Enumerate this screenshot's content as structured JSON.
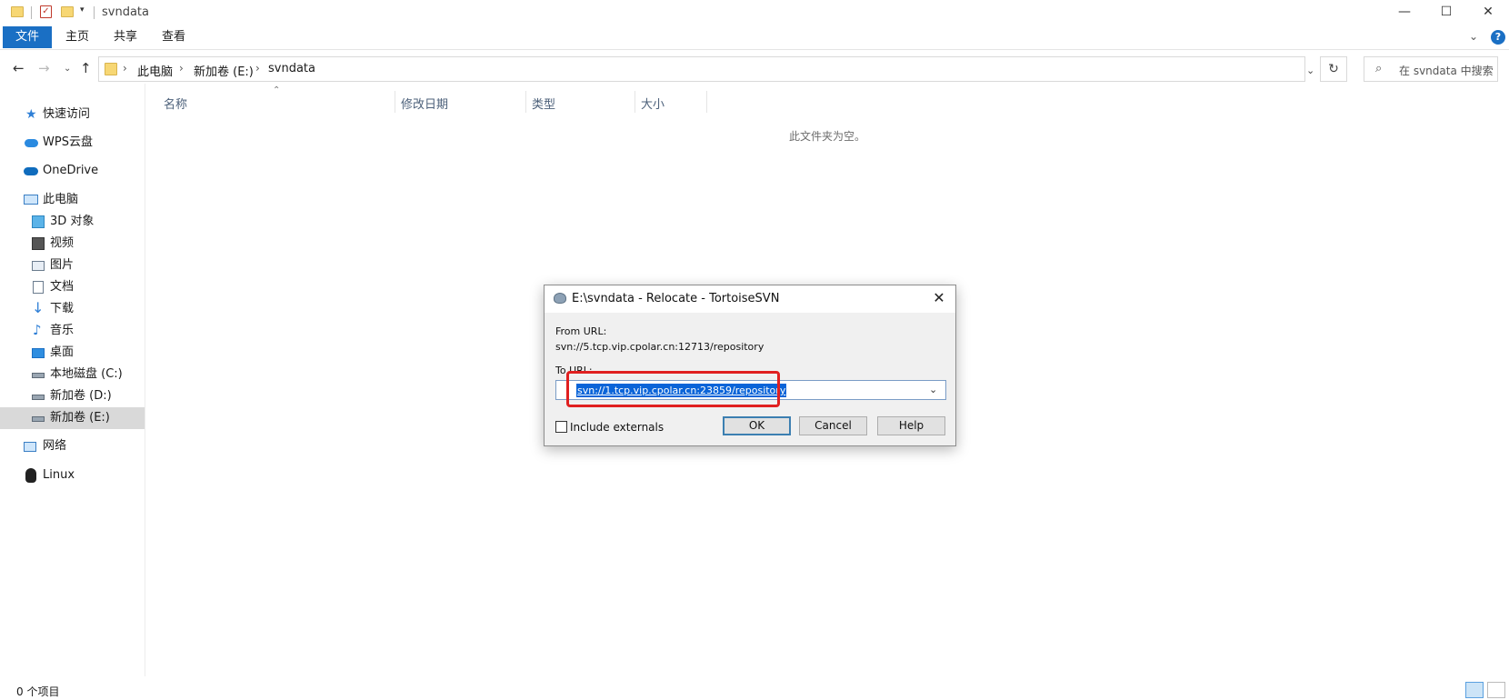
{
  "titlebar": {
    "title": "svndata",
    "minimize": "—",
    "maximize": "☐",
    "close": "✕"
  },
  "ribbon": {
    "tabs": [
      "文件",
      "主页",
      "共享",
      "查看"
    ],
    "help": "?"
  },
  "address": {
    "crumbs": [
      "此电脑",
      "新加卷 (E:)",
      "svndata"
    ],
    "search_placeholder": "在 svndata 中搜索"
  },
  "sidebar": {
    "items": [
      {
        "label": "快速访问",
        "icon": "star-icon"
      },
      {
        "label": "WPS云盘",
        "icon": "cloud-icon"
      },
      {
        "label": "OneDrive",
        "icon": "onedrive-icon"
      },
      {
        "label": "此电脑",
        "icon": "computer-icon"
      },
      {
        "label": "3D 对象",
        "icon": "cube-icon"
      },
      {
        "label": "视频",
        "icon": "video-icon"
      },
      {
        "label": "图片",
        "icon": "picture-icon"
      },
      {
        "label": "文档",
        "icon": "document-icon"
      },
      {
        "label": "下载",
        "icon": "download-icon"
      },
      {
        "label": "音乐",
        "icon": "music-icon"
      },
      {
        "label": "桌面",
        "icon": "desktop-icon"
      },
      {
        "label": "本地磁盘 (C:)",
        "icon": "drive-c-icon"
      },
      {
        "label": "新加卷 (D:)",
        "icon": "drive-icon"
      },
      {
        "label": "新加卷 (E:)",
        "icon": "drive-icon",
        "selected": true
      },
      {
        "label": "网络",
        "icon": "network-icon"
      },
      {
        "label": "Linux",
        "icon": "linux-icon"
      }
    ]
  },
  "columns": [
    "名称",
    "修改日期",
    "类型",
    "大小"
  ],
  "empty_message": "此文件夹为空。",
  "status": {
    "item_count": "0 个项目"
  },
  "dialog": {
    "title": "E:\\svndata - Relocate - TortoiseSVN",
    "from_label": "From URL:",
    "from_url": "svn://5.tcp.vip.cpolar.cn:12713/repository",
    "to_label": "To URL:",
    "to_url": "svn://1.tcp.vip.cpolar.cn:23859/repository",
    "include_externals_label": "Include externals",
    "include_externals_checked": false,
    "ok_label": "OK",
    "cancel_label": "Cancel",
    "help_label": "Help",
    "highlight_color": "#e02020"
  },
  "colors": {
    "accent": "#1a6fc4",
    "selection": "#0a64d8"
  }
}
